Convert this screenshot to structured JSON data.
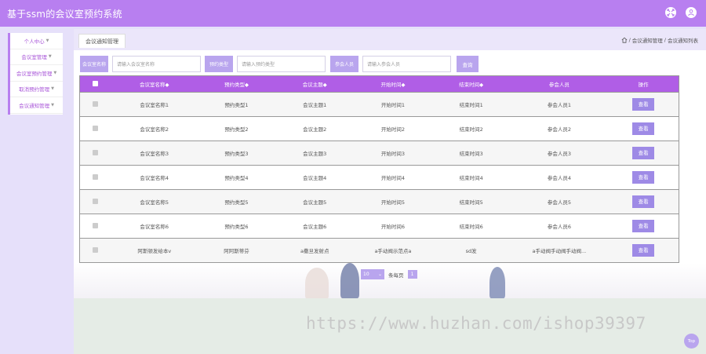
{
  "app": {
    "title": "基于ssm的会议室预约系统"
  },
  "sidebar": {
    "items": [
      {
        "label": "个人中心"
      },
      {
        "label": "会议室管理"
      },
      {
        "label": "会议室预约管理"
      },
      {
        "label": "取消预约管理"
      },
      {
        "label": "会议通知管理"
      }
    ]
  },
  "breadcrumb": {
    "tab": "会议通知管理",
    "path_1": "会议通知管理",
    "sep": "/",
    "path_2": "会议通知列表"
  },
  "search": {
    "room_name_label": "会议室名称",
    "room_name_placeholder": "请输入会议室名称",
    "booking_type_label": "预约类型",
    "booking_type_placeholder": "请输入预约类型",
    "attendee_label": "参会人员",
    "attendee_placeholder": "请输入参会人员",
    "query_button": "查询"
  },
  "table": {
    "columns": [
      "会议室名称◆",
      "预约类型◆",
      "会议主题◆",
      "开始时间◆",
      "结束时间◆",
      "参会人员",
      "操作"
    ],
    "action_label": "查看",
    "rows": [
      [
        "会议室名称1",
        "预约类型1",
        "会议主题1",
        "开始时间1",
        "结束时间1",
        "参会人员1"
      ],
      [
        "会议室名称2",
        "预约类型2",
        "会议主题2",
        "开始时间2",
        "结束时间2",
        "参会人员2"
      ],
      [
        "会议室名称3",
        "预约类型3",
        "会议主题3",
        "开始时间3",
        "结束时间3",
        "参会人员3"
      ],
      [
        "会议室名称4",
        "预约类型4",
        "会议主题4",
        "开始时间4",
        "结束时间4",
        "参会人员4"
      ],
      [
        "会议室名称5",
        "预约类型5",
        "会议主题5",
        "开始时间5",
        "结束时间5",
        "参会人员5"
      ],
      [
        "会议室名称6",
        "预约类型6",
        "会议主题6",
        "开始时间6",
        "结束时间6",
        "参会人员6"
      ],
      [
        "阿斯顿发给本v",
        "阿阿斯蒂芬",
        "a撒旦发射点",
        "a手动阀示范点a",
        "sd发",
        "a手动阀手动阀手动阀..."
      ]
    ]
  },
  "pagination": {
    "page_size": "10",
    "per_page_label": "条每页",
    "current_page": "1"
  },
  "watermark": "https://www.huzhan.com/ishop39397",
  "back_to_top": "Top",
  "colors": {
    "topbar": "#b87ff0",
    "table_header": "#b05ee6",
    "button": "#9e8ae6",
    "label": "#b9a5ee"
  }
}
